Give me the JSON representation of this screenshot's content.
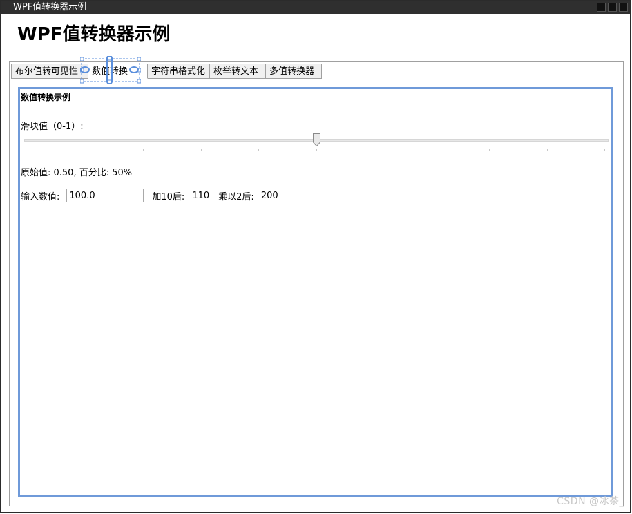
{
  "window": {
    "title": "WPF值转换器示例",
    "controls": [
      "minimize",
      "maximize",
      "close"
    ]
  },
  "page": {
    "title": "WPF值转换器示例"
  },
  "tabs": [
    {
      "label": "布尔值转可见性",
      "active": false
    },
    {
      "label": "数值转换",
      "active": true
    },
    {
      "label": "字符串格式化",
      "active": false
    },
    {
      "label": "枚举转文本",
      "active": false
    },
    {
      "label": "多值转换器",
      "active": false
    }
  ],
  "panel": {
    "section_title": "数值转换示例",
    "slider_label": "滑块值（0-1）:",
    "slider_value": 0.5,
    "slider_min": 0,
    "slider_max": 1,
    "value_line": "原始值: 0.50, 百分比: 50%",
    "input_label": "输入数值:",
    "input_value": "100.0",
    "add10_label": "加10后:",
    "add10_value": "110",
    "mul2_label": "乘以2后:",
    "mul2_value": "200"
  },
  "watermark": "CSDN @冰茶_",
  "colors": {
    "titlebar_bg": "#2f2f2f",
    "focus_border": "#6f9ad9",
    "designer_selection": "#5b8fdc"
  }
}
